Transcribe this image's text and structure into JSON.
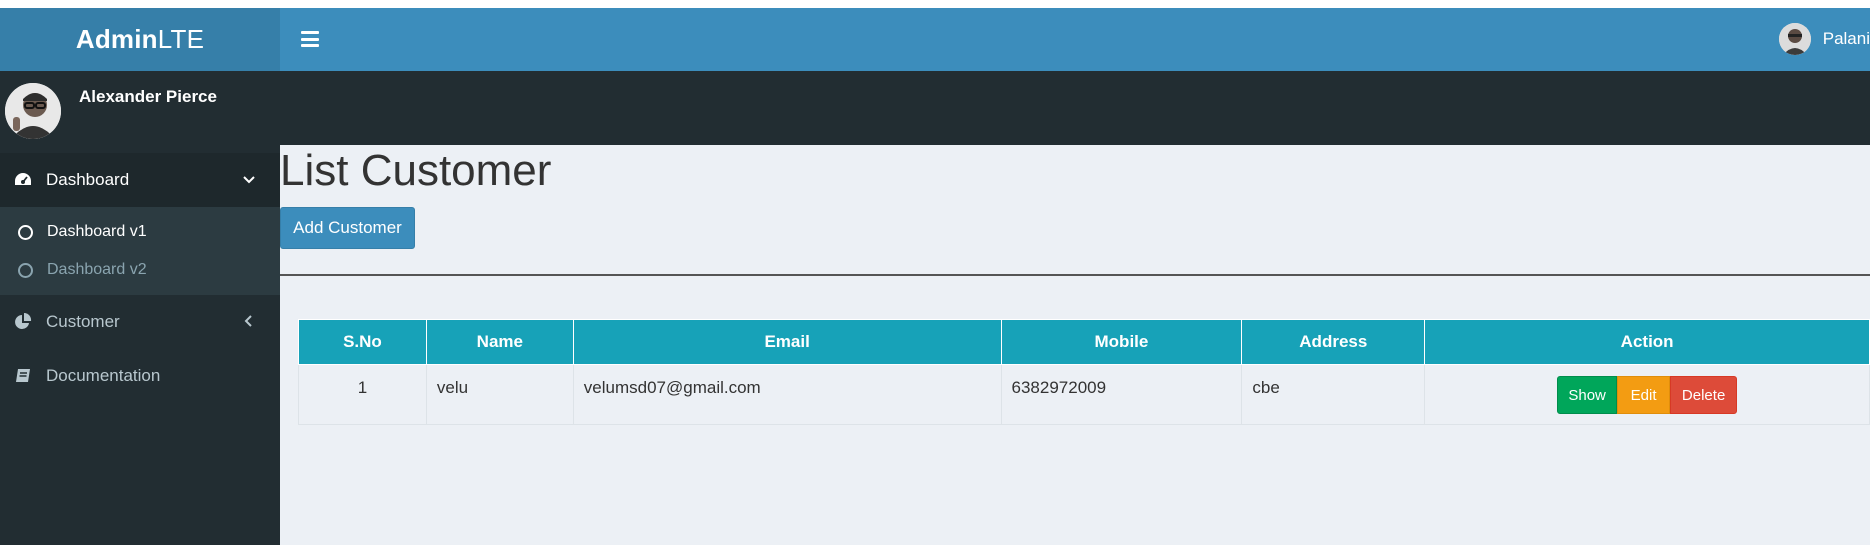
{
  "header": {
    "logo_bold": "Admin",
    "logo_light": "LTE",
    "user_name": "Palani"
  },
  "sidebar": {
    "user_name": "Alexander Pierce",
    "items": [
      {
        "label": "Dashboard",
        "icon": "dashboard-gauge-icon",
        "expanded": true,
        "children": [
          {
            "label": "Dashboard v1",
            "active": true
          },
          {
            "label": "Dashboard v2",
            "active": false
          }
        ]
      },
      {
        "label": "Customer",
        "icon": "pie-chart-icon",
        "expanded": false
      },
      {
        "label": "Documentation",
        "icon": "book-icon"
      }
    ]
  },
  "main": {
    "title": "List Customer",
    "add_button": "Add Customer",
    "table": {
      "headers": [
        "S.No",
        "Name",
        "Email",
        "Mobile",
        "Address",
        "Action"
      ],
      "rows": [
        {
          "sno": "1",
          "name": "velu",
          "email": "velumsd07@gmail.com",
          "mobile": "6382972009",
          "address": "cbe"
        }
      ],
      "actions": {
        "show": "Show",
        "edit": "Edit",
        "delete": "Delete"
      }
    }
  },
  "colors": {
    "navbar": "#3c8dbc",
    "logo_bg": "#367fa9",
    "sidebar": "#222d32",
    "table_header": "#17a2b8",
    "show": "#00a65a",
    "edit": "#f39c12",
    "delete": "#dd4b39"
  }
}
